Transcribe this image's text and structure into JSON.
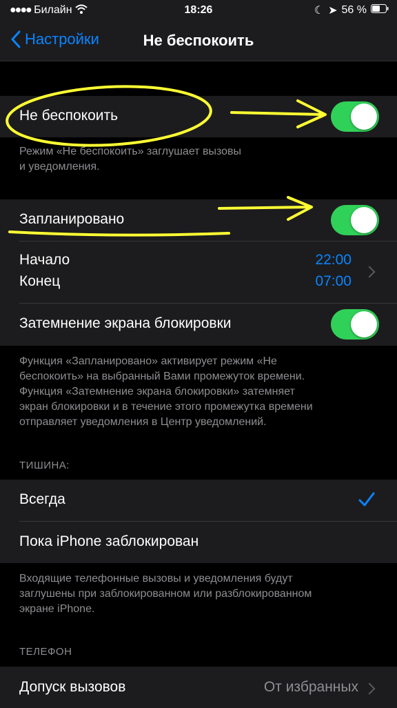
{
  "status": {
    "carrier": "Билайн",
    "time": "18:26",
    "battery": "56 %"
  },
  "nav": {
    "back_label": "Настройки",
    "title": "Не беспокоить"
  },
  "dnd": {
    "label": "Не беспокоить",
    "on": true,
    "footer_line1": "Режим «Не беспокоить» заглушает вызовы",
    "footer_line2": "и уведомления."
  },
  "scheduled": {
    "label": "Запланировано",
    "on": true,
    "start_label": "Начало",
    "start_value": "22:00",
    "end_label": "Конец",
    "end_value": "07:00",
    "dim_label": "Затемнение экрана блокировки",
    "dim_on": true,
    "footer_lines": [
      "Функция «Запланировано» активирует режим «Не",
      "беспокоить» на выбранный Вами промежуток времени.",
      "Функция «Затемнение экрана блокировки» затемняет",
      "экран блокировки и в течение этого промежутка времени",
      "отправляет уведомления в Центр уведомлений."
    ]
  },
  "silence": {
    "header": "ТИШИНА:",
    "option_always": "Всегда",
    "option_locked": "Пока iPhone заблокирован",
    "selected": "Всегда",
    "footer_lines": [
      "Входящие телефонные вызовы и уведомления будут",
      "заглушены при заблокированном или разблокированном",
      "экране iPhone."
    ]
  },
  "phone": {
    "header": "ТЕЛЕФОН",
    "allow_calls_label": "Допуск вызовов",
    "allow_calls_value": "От избранных"
  },
  "colors": {
    "accent": "#0a84ff",
    "toggle_on": "#30d158",
    "annotation": "#ffff33"
  }
}
